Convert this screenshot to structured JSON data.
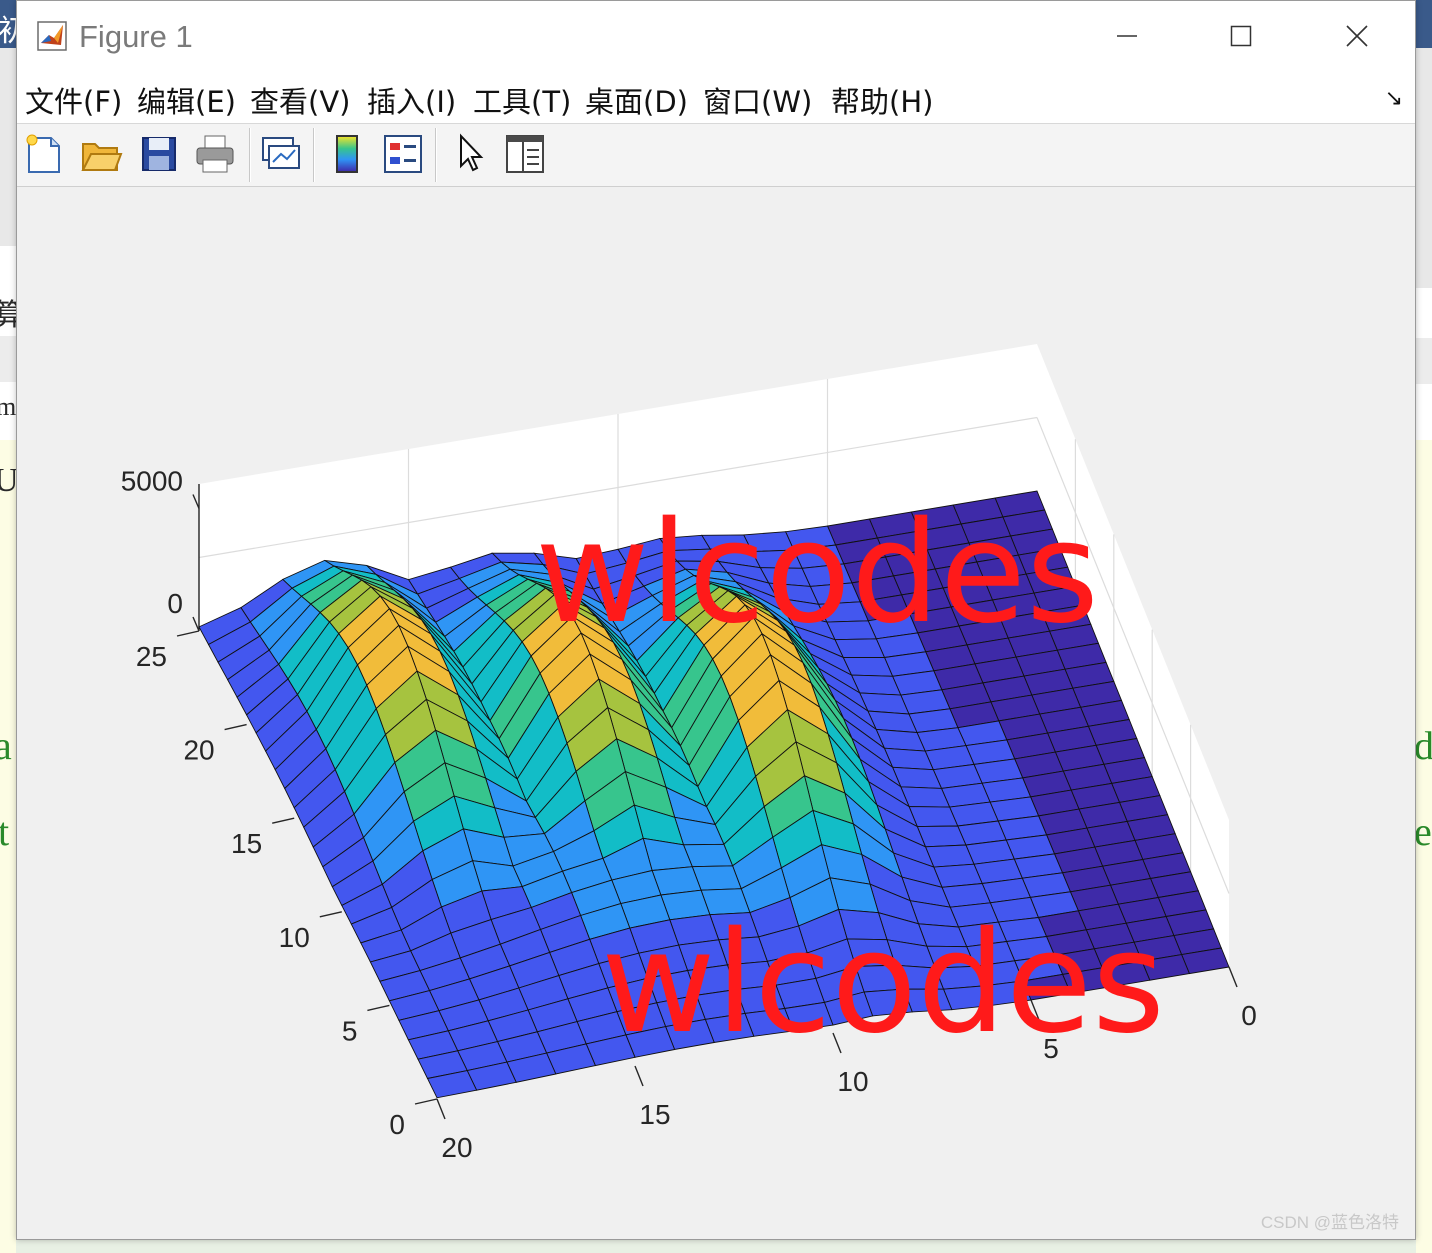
{
  "window": {
    "title": "Figure 1",
    "controls": {
      "minimize": "minimize",
      "maximize": "maximize",
      "close": "close"
    }
  },
  "menu": [
    "文件(F)",
    "编辑(E)",
    "查看(V)",
    "插入(I)",
    "工具(T)",
    "桌面(D)",
    "窗口(W)",
    "帮助(H)"
  ],
  "menu_overflow": "↘",
  "toolbar": [
    "new-figure-icon",
    "open-file-icon",
    "save-icon",
    "print-icon",
    "link-plot-icon",
    "colorbar-icon",
    "legend-icon",
    "edit-plot-icon",
    "property-inspector-icon"
  ],
  "background_fragments": {
    "left": [
      "初",
      "算",
      "m",
      "U",
      "a",
      "t"
    ],
    "right": [
      "d",
      "e"
    ]
  },
  "annotations": [
    "wlcodes",
    "wlcodes"
  ],
  "footer_watermark": "CSDN @蓝色洛特",
  "colors": {
    "annotation": "#ff1a1a",
    "base_plane": "#3e2aa8",
    "colormap": [
      "#3e26a8",
      "#4357ef",
      "#2f95f5",
      "#12bdc7",
      "#37c58d",
      "#a6c33f",
      "#f1bc3a",
      "#f8e427"
    ]
  },
  "chart_data": {
    "type": "surface",
    "colormap": "parula",
    "grid": true,
    "x_ticks": [
      "0",
      "5",
      "10",
      "15",
      "20"
    ],
    "y_ticks": [
      "0",
      "5",
      "10",
      "15",
      "20",
      "25"
    ],
    "z_ticks": [
      "0",
      "5000"
    ],
    "x_range": [
      0,
      20
    ],
    "y_range": [
      0,
      25
    ],
    "z_range": [
      0,
      6000
    ],
    "peaks": [
      {
        "x": 17,
        "y": 17,
        "z": 5500
      },
      {
        "x": 13,
        "y": 15,
        "z": 5600
      },
      {
        "x": 9,
        "y": 13,
        "z": 6000
      }
    ]
  }
}
